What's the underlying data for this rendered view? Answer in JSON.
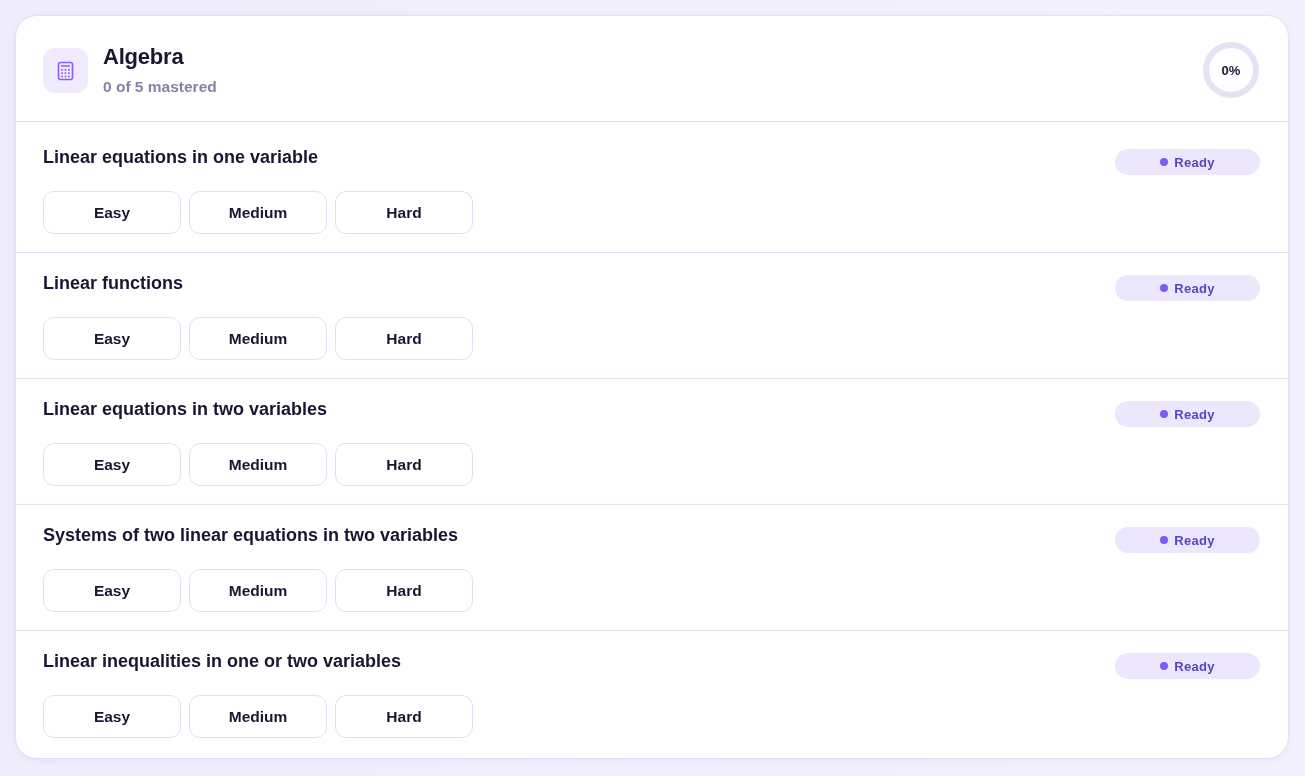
{
  "subject": {
    "title": "Algebra",
    "subtitle": "0 of 5 mastered",
    "progress": {
      "label": "0%"
    }
  },
  "topics": [
    {
      "title": "Linear equations in one variable",
      "status": {
        "kind": "ready",
        "label": "Ready"
      },
      "levels": [
        "Easy",
        "Medium",
        "Hard"
      ]
    },
    {
      "title": "Linear functions",
      "status": {
        "kind": "ready",
        "label": "Ready"
      },
      "levels": [
        "Easy",
        "Medium",
        "Hard"
      ]
    },
    {
      "title": "Linear equations in two variables",
      "status": {
        "kind": "ready",
        "label": "Ready"
      },
      "levels": [
        "Easy",
        "Medium",
        "Hard"
      ]
    },
    {
      "title": "Systems of two linear equations in two variables",
      "status": {
        "kind": "ready",
        "label": "Ready"
      },
      "levels": [
        "Easy",
        "Medium",
        "Hard"
      ]
    },
    {
      "title": "Linear inequalities in one or two variables",
      "status": {
        "kind": "ready",
        "label": "Ready"
      },
      "levels": [
        "Easy",
        "Medium",
        "Hard"
      ]
    }
  ]
}
